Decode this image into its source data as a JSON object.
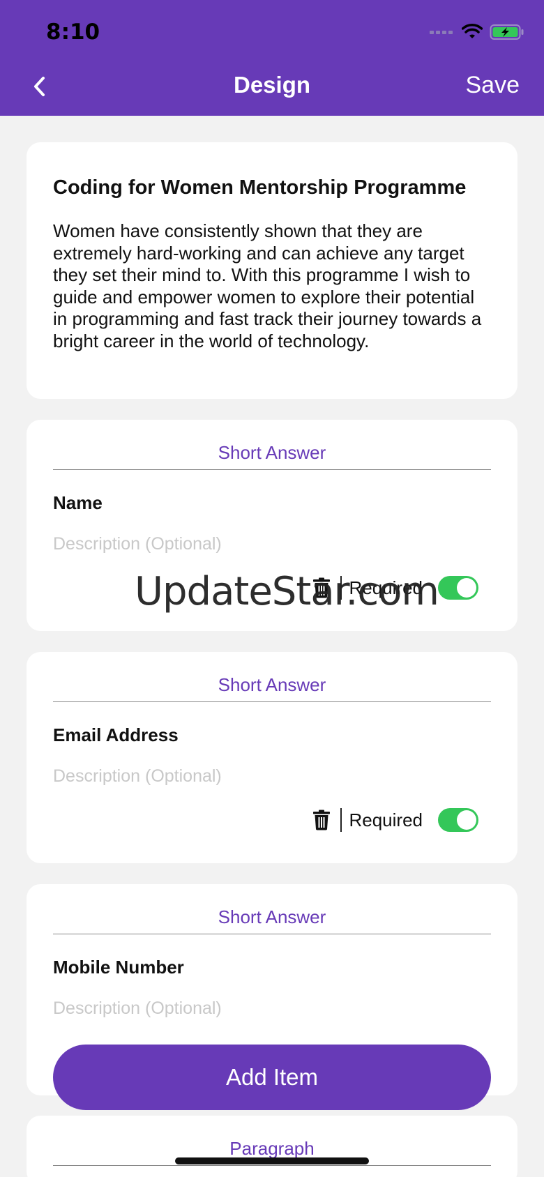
{
  "status_bar": {
    "time": "8:10"
  },
  "nav": {
    "back_icon": "chevron-left-icon",
    "title": "Design",
    "save_label": "Save"
  },
  "intro": {
    "title": "Coding for Women Mentorship Programme",
    "text": "Women have consistently shown that they are extremely hard-working and can achieve any target they set their mind to. With this programme I wish to guide and empower women to explore their potential in programming and fast track their journey towards a bright career in the world of technology."
  },
  "questions": [
    {
      "type": "Short Answer",
      "label": "Name",
      "description_placeholder": "Description (Optional)",
      "required_label": "Required",
      "required": true
    },
    {
      "type": "Short Answer",
      "label": "Email Address",
      "description_placeholder": "Description (Optional)",
      "required_label": "Required",
      "required": true
    },
    {
      "type": "Short Answer",
      "label": "Mobile Number",
      "description_placeholder": "Description (Optional)"
    },
    {
      "type": "Paragraph"
    }
  ],
  "add_item_label": "Add Item",
  "watermark": "UpdateStar.com",
  "colors": {
    "accent": "#673ab7",
    "toggle_on": "#34c759",
    "background": "#f2f2f2"
  }
}
